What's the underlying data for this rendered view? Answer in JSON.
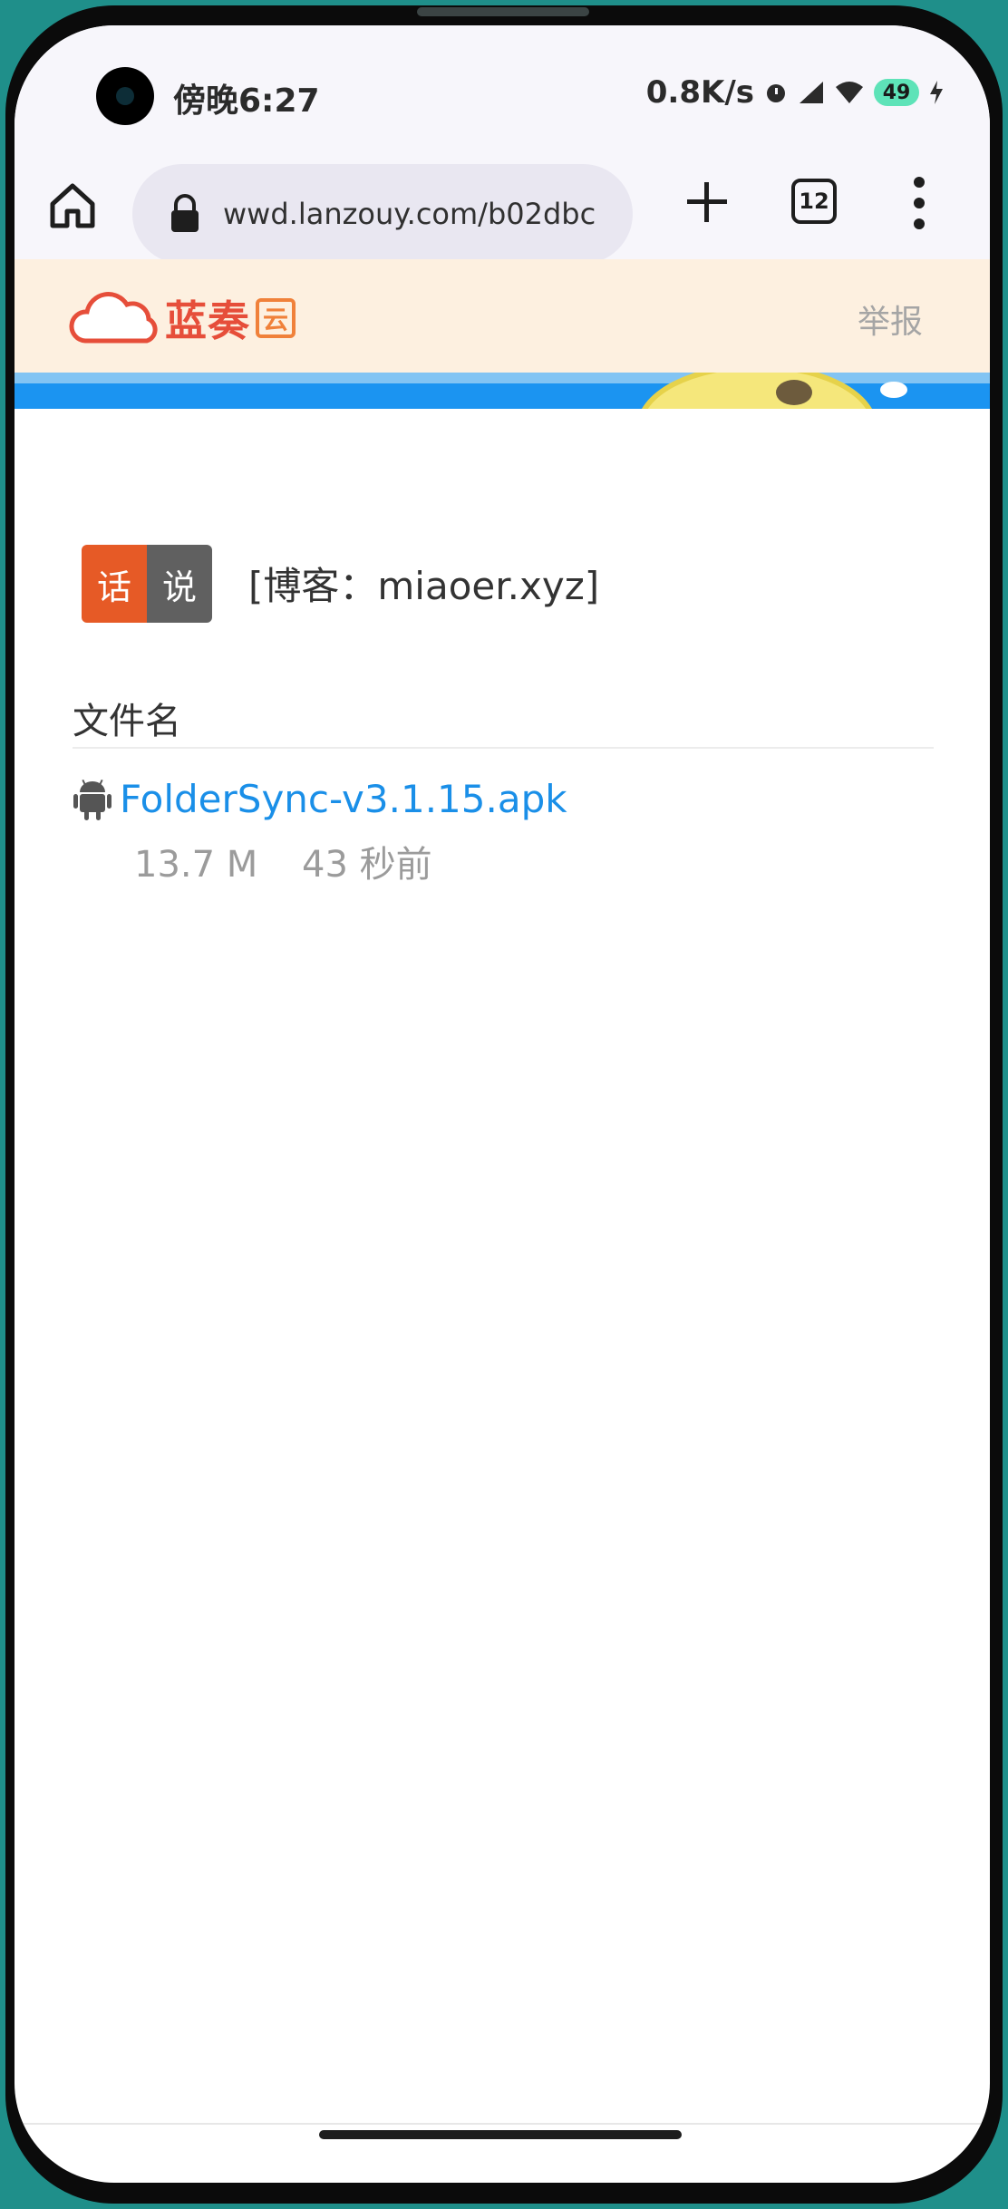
{
  "status_bar": {
    "time": "傍晚6:27",
    "net_speed": "0.8K/s",
    "battery": "49"
  },
  "browser": {
    "url": "wwd.lanzouy.com/b02dbc",
    "tabs_count": "12",
    "icons": [
      "home-icon",
      "lock-icon",
      "plus-icon",
      "tabs-icon",
      "more-vertical-icon"
    ]
  },
  "site": {
    "logo_text": "蓝奏",
    "logo_badge": "云",
    "report_label": "举报"
  },
  "blog": {
    "tag_left": "话",
    "tag_right": "说",
    "text": "[博客：miaoer.xyz]"
  },
  "files": {
    "header": "文件名",
    "items": [
      {
        "name": "FolderSync-v3.1.15.apk",
        "size": "13.7 M",
        "time": "43 秒前",
        "icon": "android-icon"
      }
    ]
  },
  "colors": {
    "link": "#1a8fe8",
    "tag_orange": "#e65a26",
    "tag_gray": "#606060",
    "header_bg": "#fdf0e0",
    "banner_blue": "#1b94f1"
  }
}
